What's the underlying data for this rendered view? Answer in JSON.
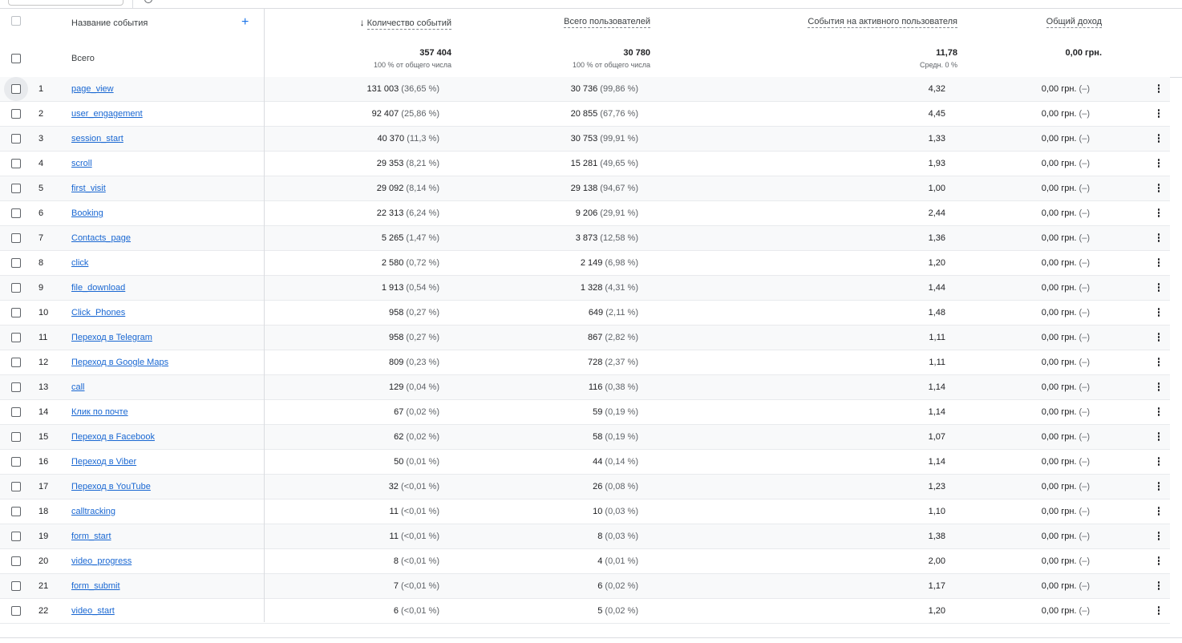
{
  "header": {
    "event_name": "Название события",
    "add": "+",
    "sort_arrow": "🡓",
    "col_events": "Количество событий",
    "col_users": "Всего пользователей",
    "col_per_user": "События на активного пользователя",
    "col_revenue": "Общий доход"
  },
  "totals": {
    "label": "Всего",
    "events": "357 404",
    "events_sub": "100 % от общего числа",
    "users": "30 780",
    "users_sub": "100 % от общего числа",
    "per_user": "11,78",
    "per_user_sub": "Средн. 0 %",
    "revenue": "0,00 грн."
  },
  "rows": [
    {
      "n": "1",
      "name": "page_view",
      "events": "131 003",
      "events_pct": "(36,65 %)",
      "users": "30 736",
      "users_pct": "(99,86 %)",
      "per_user": "4,32",
      "revenue": "0,00 грн.",
      "rev_pct": "(–)"
    },
    {
      "n": "2",
      "name": "user_engagement",
      "events": "92 407",
      "events_pct": "(25,86 %)",
      "users": "20 855",
      "users_pct": "(67,76 %)",
      "per_user": "4,45",
      "revenue": "0,00 грн.",
      "rev_pct": "(–)"
    },
    {
      "n": "3",
      "name": "session_start",
      "events": "40 370",
      "events_pct": "(11,3 %)",
      "users": "30 753",
      "users_pct": "(99,91 %)",
      "per_user": "1,33",
      "revenue": "0,00 грн.",
      "rev_pct": "(–)"
    },
    {
      "n": "4",
      "name": "scroll",
      "events": "29 353",
      "events_pct": "(8,21 %)",
      "users": "15 281",
      "users_pct": "(49,65 %)",
      "per_user": "1,93",
      "revenue": "0,00 грн.",
      "rev_pct": "(–)"
    },
    {
      "n": "5",
      "name": "first_visit",
      "events": "29 092",
      "events_pct": "(8,14 %)",
      "users": "29 138",
      "users_pct": "(94,67 %)",
      "per_user": "1,00",
      "revenue": "0,00 грн.",
      "rev_pct": "(–)"
    },
    {
      "n": "6",
      "name": "Booking",
      "events": "22 313",
      "events_pct": "(6,24 %)",
      "users": "9 206",
      "users_pct": "(29,91 %)",
      "per_user": "2,44",
      "revenue": "0,00 грн.",
      "rev_pct": "(–)"
    },
    {
      "n": "7",
      "name": "Contacts_page",
      "events": "5 265",
      "events_pct": "(1,47 %)",
      "users": "3 873",
      "users_pct": "(12,58 %)",
      "per_user": "1,36",
      "revenue": "0,00 грн.",
      "rev_pct": "(–)"
    },
    {
      "n": "8",
      "name": "click",
      "events": "2 580",
      "events_pct": "(0,72 %)",
      "users": "2 149",
      "users_pct": "(6,98 %)",
      "per_user": "1,20",
      "revenue": "0,00 грн.",
      "rev_pct": "(–)"
    },
    {
      "n": "9",
      "name": "file_download",
      "events": "1 913",
      "events_pct": "(0,54 %)",
      "users": "1 328",
      "users_pct": "(4,31 %)",
      "per_user": "1,44",
      "revenue": "0,00 грн.",
      "rev_pct": "(–)"
    },
    {
      "n": "10",
      "name": "Click_Phones",
      "events": "958",
      "events_pct": "(0,27 %)",
      "users": "649",
      "users_pct": "(2,11 %)",
      "per_user": "1,48",
      "revenue": "0,00 грн.",
      "rev_pct": "(–)"
    },
    {
      "n": "11",
      "name": "Переход в Telegram",
      "events": "958",
      "events_pct": "(0,27 %)",
      "users": "867",
      "users_pct": "(2,82 %)",
      "per_user": "1,11",
      "revenue": "0,00 грн.",
      "rev_pct": "(–)"
    },
    {
      "n": "12",
      "name": "Переход в Google Maps",
      "events": "809",
      "events_pct": "(0,23 %)",
      "users": "728",
      "users_pct": "(2,37 %)",
      "per_user": "1,11",
      "revenue": "0,00 грн.",
      "rev_pct": "(–)"
    },
    {
      "n": "13",
      "name": "call",
      "events": "129",
      "events_pct": "(0,04 %)",
      "users": "116",
      "users_pct": "(0,38 %)",
      "per_user": "1,14",
      "revenue": "0,00 грн.",
      "rev_pct": "(–)"
    },
    {
      "n": "14",
      "name": "Клик по почте",
      "events": "67",
      "events_pct": "(0,02 %)",
      "users": "59",
      "users_pct": "(0,19 %)",
      "per_user": "1,14",
      "revenue": "0,00 грн.",
      "rev_pct": "(–)"
    },
    {
      "n": "15",
      "name": "Переход в Facebook",
      "events": "62",
      "events_pct": "(0,02 %)",
      "users": "58",
      "users_pct": "(0,19 %)",
      "per_user": "1,07",
      "revenue": "0,00 грн.",
      "rev_pct": "(–)"
    },
    {
      "n": "16",
      "name": "Переход в Viber",
      "events": "50",
      "events_pct": "(0,01 %)",
      "users": "44",
      "users_pct": "(0,14 %)",
      "per_user": "1,14",
      "revenue": "0,00 грн.",
      "rev_pct": "(–)"
    },
    {
      "n": "17",
      "name": "Переход в YouTube",
      "events": "32",
      "events_pct": "(<0,01 %)",
      "users": "26",
      "users_pct": "(0,08 %)",
      "per_user": "1,23",
      "revenue": "0,00 грн.",
      "rev_pct": "(–)"
    },
    {
      "n": "18",
      "name": "calltracking",
      "events": "11",
      "events_pct": "(<0,01 %)",
      "users": "10",
      "users_pct": "(0,03 %)",
      "per_user": "1,10",
      "revenue": "0,00 грн.",
      "rev_pct": "(–)"
    },
    {
      "n": "19",
      "name": "form_start",
      "events": "11",
      "events_pct": "(<0,01 %)",
      "users": "8",
      "users_pct": "(0,03 %)",
      "per_user": "1,38",
      "revenue": "0,00 грн.",
      "rev_pct": "(–)"
    },
    {
      "n": "20",
      "name": "video_progress",
      "events": "8",
      "events_pct": "(<0,01 %)",
      "users": "4",
      "users_pct": "(0,01 %)",
      "per_user": "2,00",
      "revenue": "0,00 грн.",
      "rev_pct": "(–)"
    },
    {
      "n": "21",
      "name": "form_submit",
      "events": "7",
      "events_pct": "(<0,01 %)",
      "users": "6",
      "users_pct": "(0,02 %)",
      "per_user": "1,17",
      "revenue": "0,00 грн.",
      "rev_pct": "(–)"
    },
    {
      "n": "22",
      "name": "video_start",
      "events": "6",
      "events_pct": "(<0,01 %)",
      "users": "5",
      "users_pct": "(0,02 %)",
      "per_user": "1,20",
      "revenue": "0,00 грн.",
      "rev_pct": "(–)"
    }
  ]
}
